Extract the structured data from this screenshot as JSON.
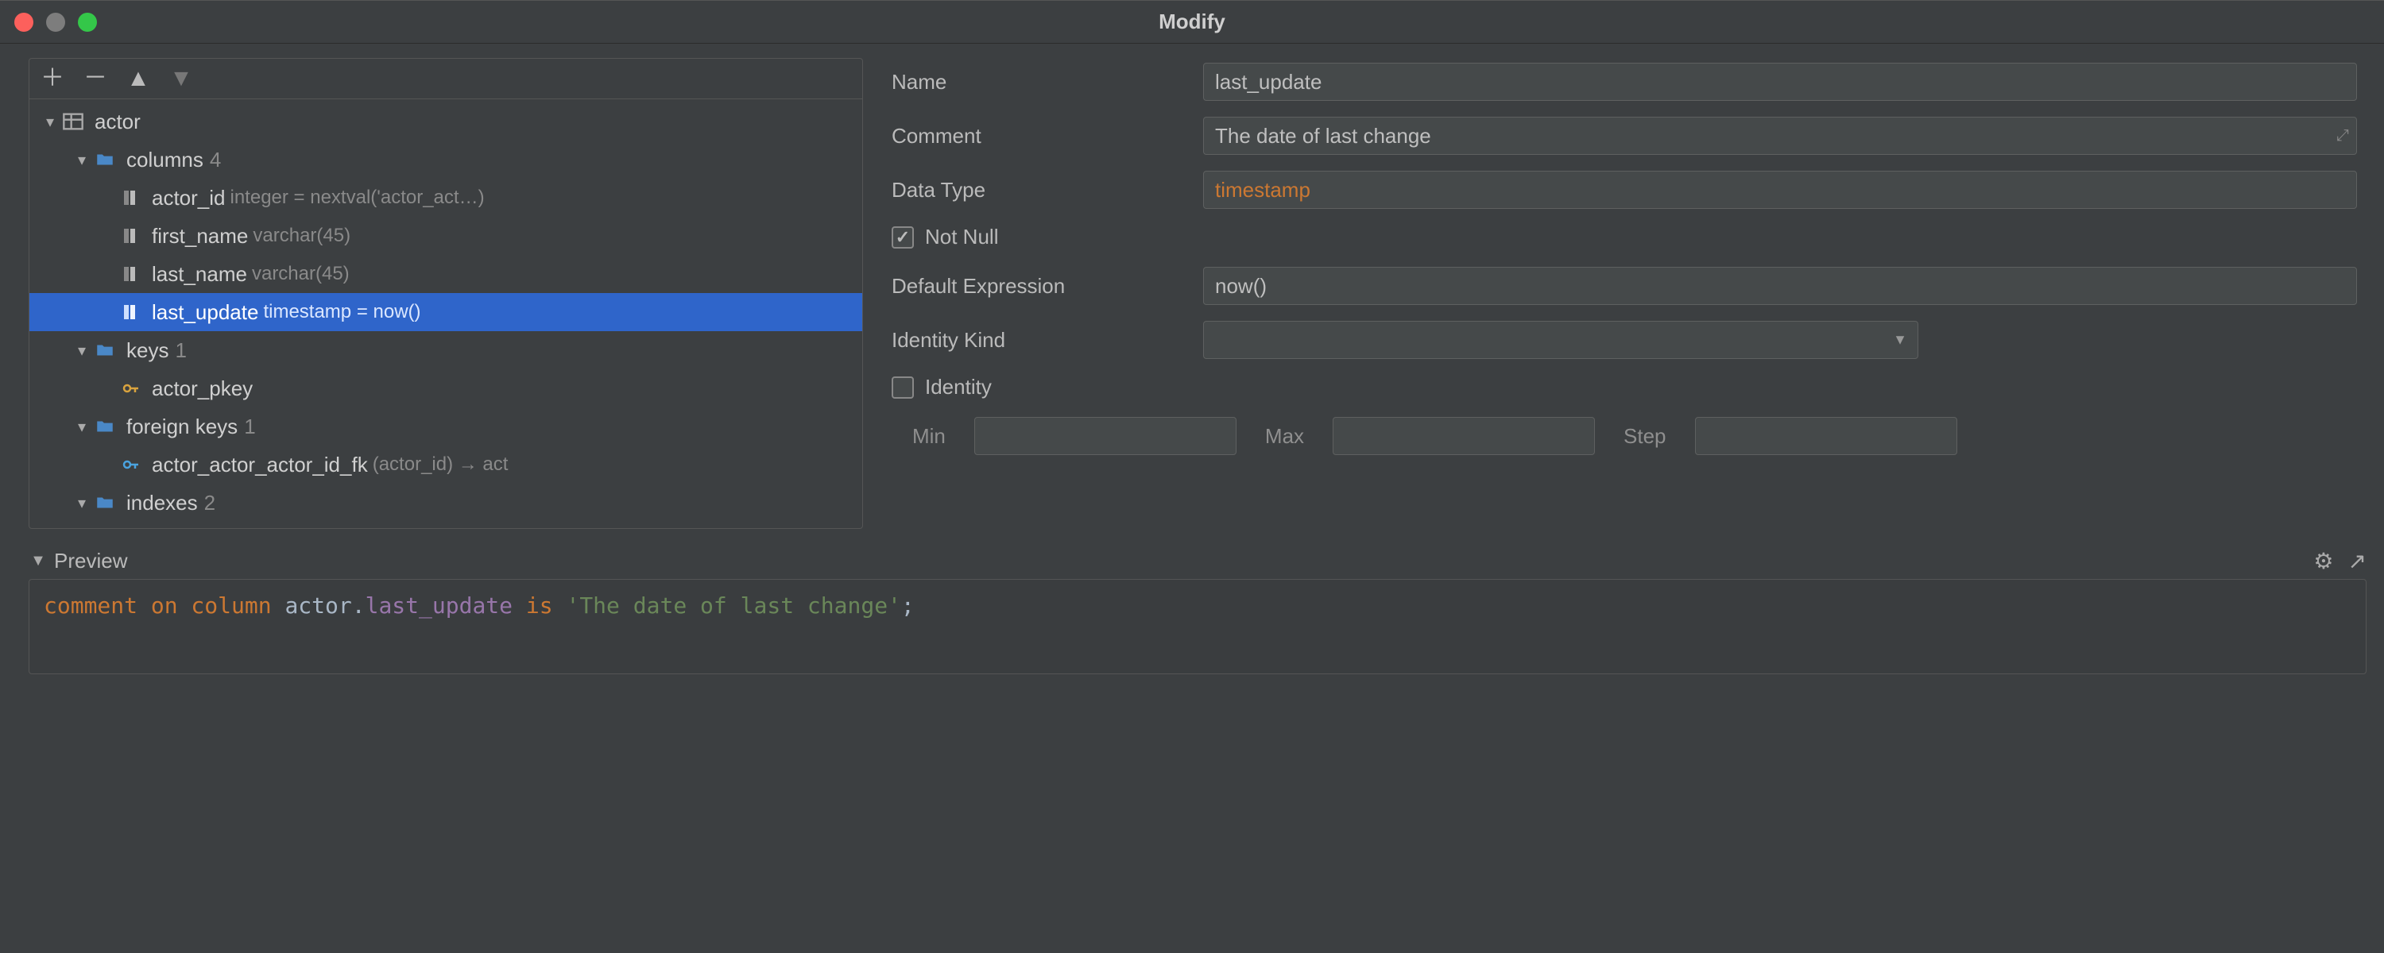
{
  "window": {
    "title": "Modify"
  },
  "tree": {
    "table": "actor",
    "columns_label": "columns",
    "columns_count": "4",
    "columns": [
      {
        "name": "actor_id",
        "type": "integer = nextval('actor_act…)"
      },
      {
        "name": "first_name",
        "type": "varchar(45)"
      },
      {
        "name": "last_name",
        "type": "varchar(45)"
      },
      {
        "name": "last_update",
        "type": "timestamp = now()"
      }
    ],
    "keys_label": "keys",
    "keys_count": "1",
    "keys": [
      {
        "name": "actor_pkey"
      }
    ],
    "fks_label": "foreign keys",
    "fks_count": "1",
    "fks": [
      {
        "name": "actor_actor_actor_id_fk",
        "detail": "(actor_id) → act"
      }
    ],
    "indexes_label": "indexes",
    "indexes_count": "2"
  },
  "form": {
    "name_label": "Name",
    "name_value": "last_update",
    "comment_label": "Comment",
    "comment_value": "The date of last change",
    "datatype_label": "Data Type",
    "datatype_value": "timestamp",
    "notnull_label": "Not Null",
    "default_label": "Default Expression",
    "default_value": "now()",
    "identitykind_label": "Identity Kind",
    "identitykind_value": "",
    "identity_label": "Identity",
    "min_label": "Min",
    "max_label": "Max",
    "step_label": "Step"
  },
  "preview": {
    "header": "Preview",
    "sql_kw1": "comment on column",
    "sql_table": "actor",
    "sql_dot": ".",
    "sql_col": "last_update",
    "sql_kw2": "is",
    "sql_str": "'The date of last change'",
    "sql_end": ";"
  }
}
